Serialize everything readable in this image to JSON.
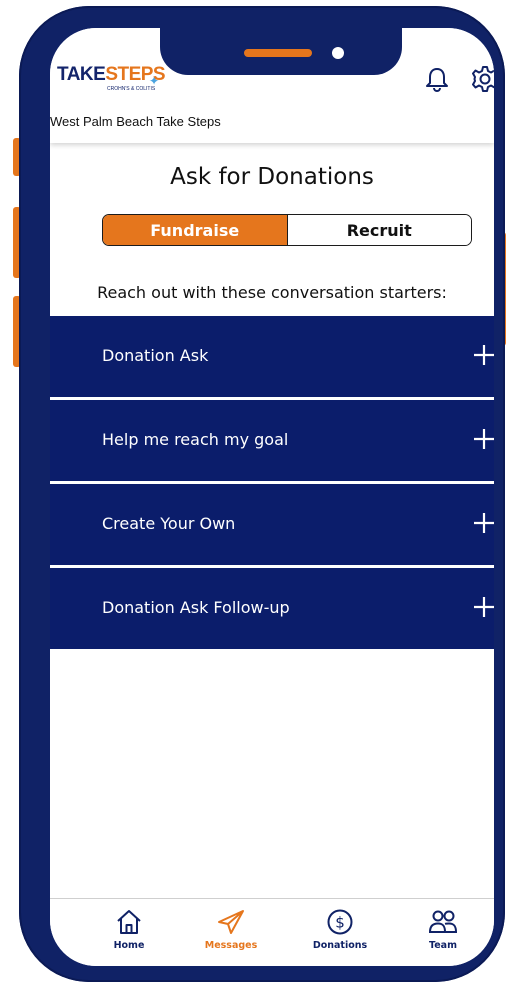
{
  "colors": {
    "navy": "#102266",
    "accordion_bg": "#0b1d6b",
    "orange": "#e5761d"
  },
  "header": {
    "logo": {
      "take": "TAKE",
      "steps": "STEPS",
      "sub": "CROHN'S & COLITIS"
    },
    "event_name": "West Palm Beach Take Steps",
    "icons": [
      "bell-icon",
      "gear-icon"
    ]
  },
  "page": {
    "title": "Ask for Donations",
    "toggle": {
      "active": "Fundraise",
      "inactive": "Recruit"
    },
    "intro": "Reach out with these conversation starters:"
  },
  "accordion": {
    "items": [
      {
        "label": "Donation Ask"
      },
      {
        "label": "Help me reach my goal"
      },
      {
        "label": "Create Your Own"
      },
      {
        "label": "Donation Ask Follow-up"
      }
    ]
  },
  "nav": {
    "items": [
      {
        "label": "Home",
        "icon": "home-icon",
        "active": false
      },
      {
        "label": "Messages",
        "icon": "paper-plane-icon",
        "active": true
      },
      {
        "label": "Donations",
        "icon": "dollar-circle-icon",
        "active": false
      },
      {
        "label": "Team",
        "icon": "people-icon",
        "active": false
      }
    ]
  }
}
